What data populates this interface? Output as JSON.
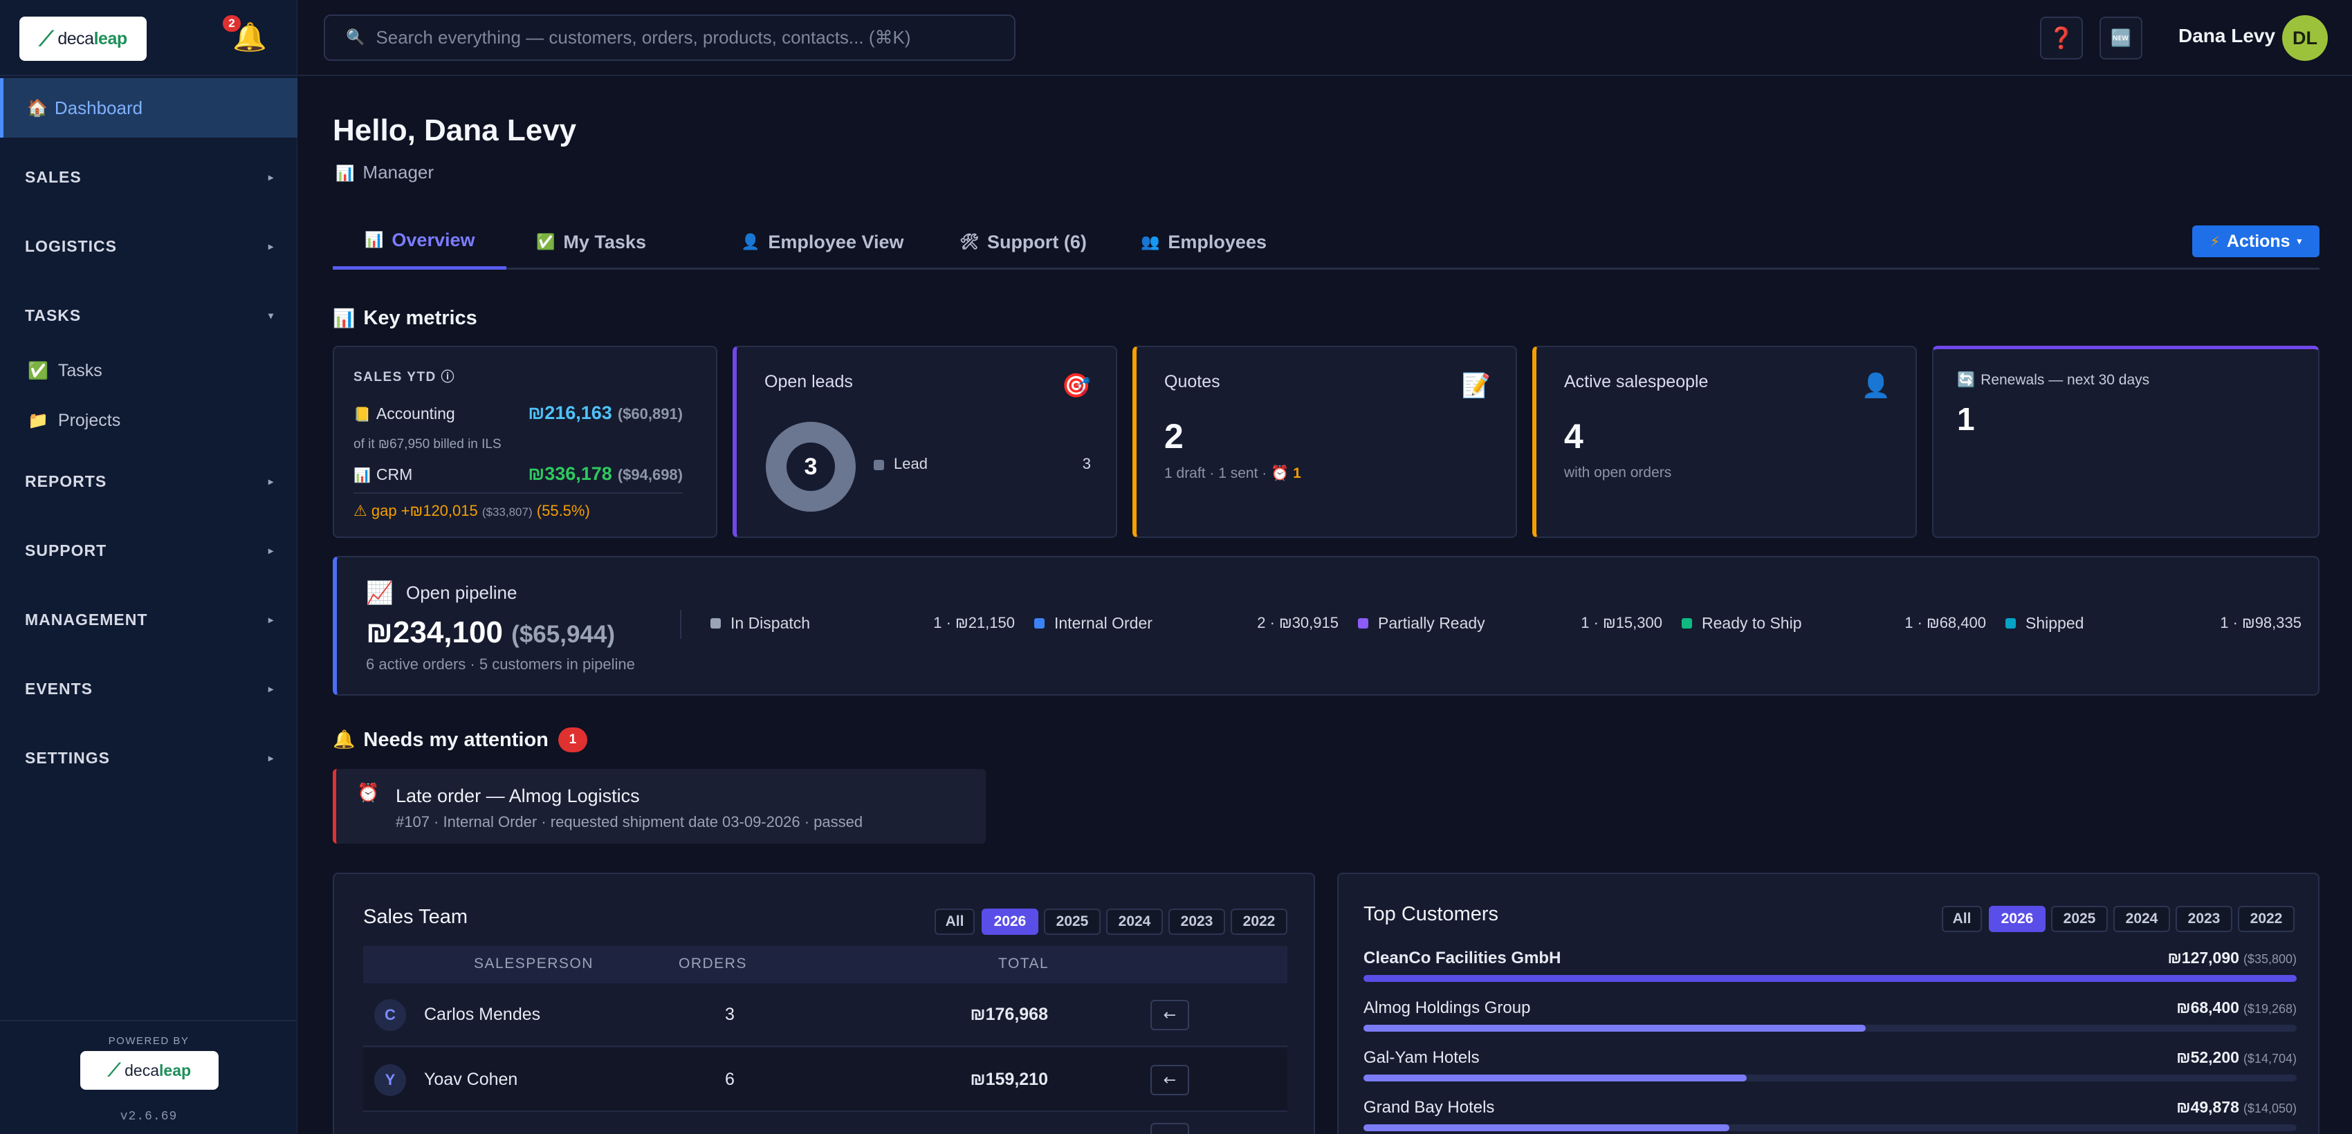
{
  "brand": {
    "logo_text_a": "deca",
    "logo_text_b": "leap",
    "notifications_count": "2",
    "powered_by": "POWERED BY",
    "version": "v2.6.69"
  },
  "sidebar": {
    "dashboard": "Dashboard",
    "sections": [
      {
        "label": "SALES",
        "chev": "▸"
      },
      {
        "label": "LOGISTICS",
        "chev": "▸"
      },
      {
        "label": "TASKS",
        "chev": "▾"
      },
      {
        "label": "REPORTS",
        "chev": "▸"
      },
      {
        "label": "SUPPORT",
        "chev": "▸"
      },
      {
        "label": "MANAGEMENT",
        "chev": "▸"
      },
      {
        "label": "EVENTS",
        "chev": "▸"
      },
      {
        "label": "SETTINGS",
        "chev": "▸"
      }
    ],
    "task_items": [
      {
        "label": "Tasks",
        "icon": "checkbox-icon"
      },
      {
        "label": "Projects",
        "icon": "folder-icon"
      }
    ]
  },
  "topbar": {
    "search_placeholder": "Search everything — customers, orders, products, contacts... (⌘K)",
    "user_name": "Dana Levy",
    "user_initials": "DL"
  },
  "header": {
    "greeting": "Hello, Dana Levy",
    "role": "Manager"
  },
  "tabs": [
    {
      "label": "Overview",
      "icon": "chart-icon"
    },
    {
      "label": "My Tasks",
      "icon": "check-icon"
    },
    {
      "label": "Employee View",
      "icon": "person-icon"
    },
    {
      "label": "Support (6)",
      "icon": "tools-icon"
    },
    {
      "label": "Employees",
      "icon": "people-icon"
    }
  ],
  "actions_label": "Actions",
  "key_metrics": {
    "title": "Key metrics",
    "sales_ytd": {
      "title": "SALES YTD ⓘ",
      "accounting_label": "Accounting",
      "accounting_value": "₪216,163",
      "accounting_paren": "($60,891)",
      "note": "of it ₪67,950 billed in ILS",
      "crm_label": "CRM",
      "crm_value": "₪336,178",
      "crm_paren": "($94,698)",
      "gap": "gap +₪120,015",
      "gap_small": "($33,807)",
      "gap_pct": "(55.5%)"
    },
    "open_leads": {
      "title": "Open leads",
      "count": "3",
      "legend_label": "Lead",
      "legend_value": "3"
    },
    "quotes": {
      "title": "Quotes",
      "count": "2",
      "sub": "1 draft · 1 sent · ",
      "late": "1"
    },
    "salespeople": {
      "title": "Active salespeople",
      "count": "4",
      "sub": "with open orders"
    },
    "renewals": {
      "title": "Renewals — next 30 days",
      "count": "1"
    }
  },
  "pipeline": {
    "title": "Open pipeline",
    "total": "₪234,100",
    "total_paren": "($65,944)",
    "sub": "6 active orders · 5 customers in pipeline",
    "stages": [
      {
        "label": "In Dispatch",
        "value": "1 · ₪21,150",
        "color": "#9aa3b8"
      },
      {
        "label": "Internal Order",
        "value": "2 · ₪30,915",
        "color": "#3b82f6"
      },
      {
        "label": "Partially Ready",
        "value": "1 · ₪15,300",
        "color": "#8b5cf6"
      },
      {
        "label": "Ready to Ship",
        "value": "1 · ₪68,400",
        "color": "#10b981"
      },
      {
        "label": "Shipped",
        "value": "1 · ₪98,335",
        "color": "#06a3c4"
      }
    ]
  },
  "attention": {
    "title": "Needs my attention",
    "count": "1",
    "item_title": "Late order — Almog Logistics",
    "item_sub": "#107 · Internal Order · requested shipment date 03-09-2026 · passed"
  },
  "sales_team": {
    "title": "Sales Team",
    "years": [
      "All",
      "2026",
      "2025",
      "2024",
      "2023",
      "2022"
    ],
    "columns": [
      "SALESPERSON",
      "ORDERS",
      "TOTAL"
    ],
    "rows": [
      {
        "initial": "C",
        "name": "Carlos Mendes",
        "orders": "3",
        "total": "₪176,968"
      },
      {
        "initial": "Y",
        "name": "Yoav Cohen",
        "orders": "6",
        "total": "₪159,210"
      }
    ]
  },
  "top_customers": {
    "title": "Top Customers",
    "years": [
      "All",
      "2026",
      "2025",
      "2024",
      "2023",
      "2022"
    ],
    "rows": [
      {
        "name": "CleanCo Facilities GmbH",
        "value": "₪127,090",
        "paren": "($35,800)",
        "share": 1.0
      },
      {
        "name": "Almog Holdings Group",
        "value": "₪68,400",
        "paren": "($19,268)",
        "share": 0.538
      },
      {
        "name": "Gal-Yam Hotels",
        "value": "₪52,200",
        "paren": "($14,704)",
        "share": 0.411
      },
      {
        "name": "Grand Bay Hotels",
        "value": "₪49,878",
        "paren": "($14,050)",
        "share": 0.392
      }
    ]
  },
  "colors": {
    "accent": "#5a4ee8",
    "brand_green": "#1e8f5a",
    "alert_red": "#e03131"
  }
}
